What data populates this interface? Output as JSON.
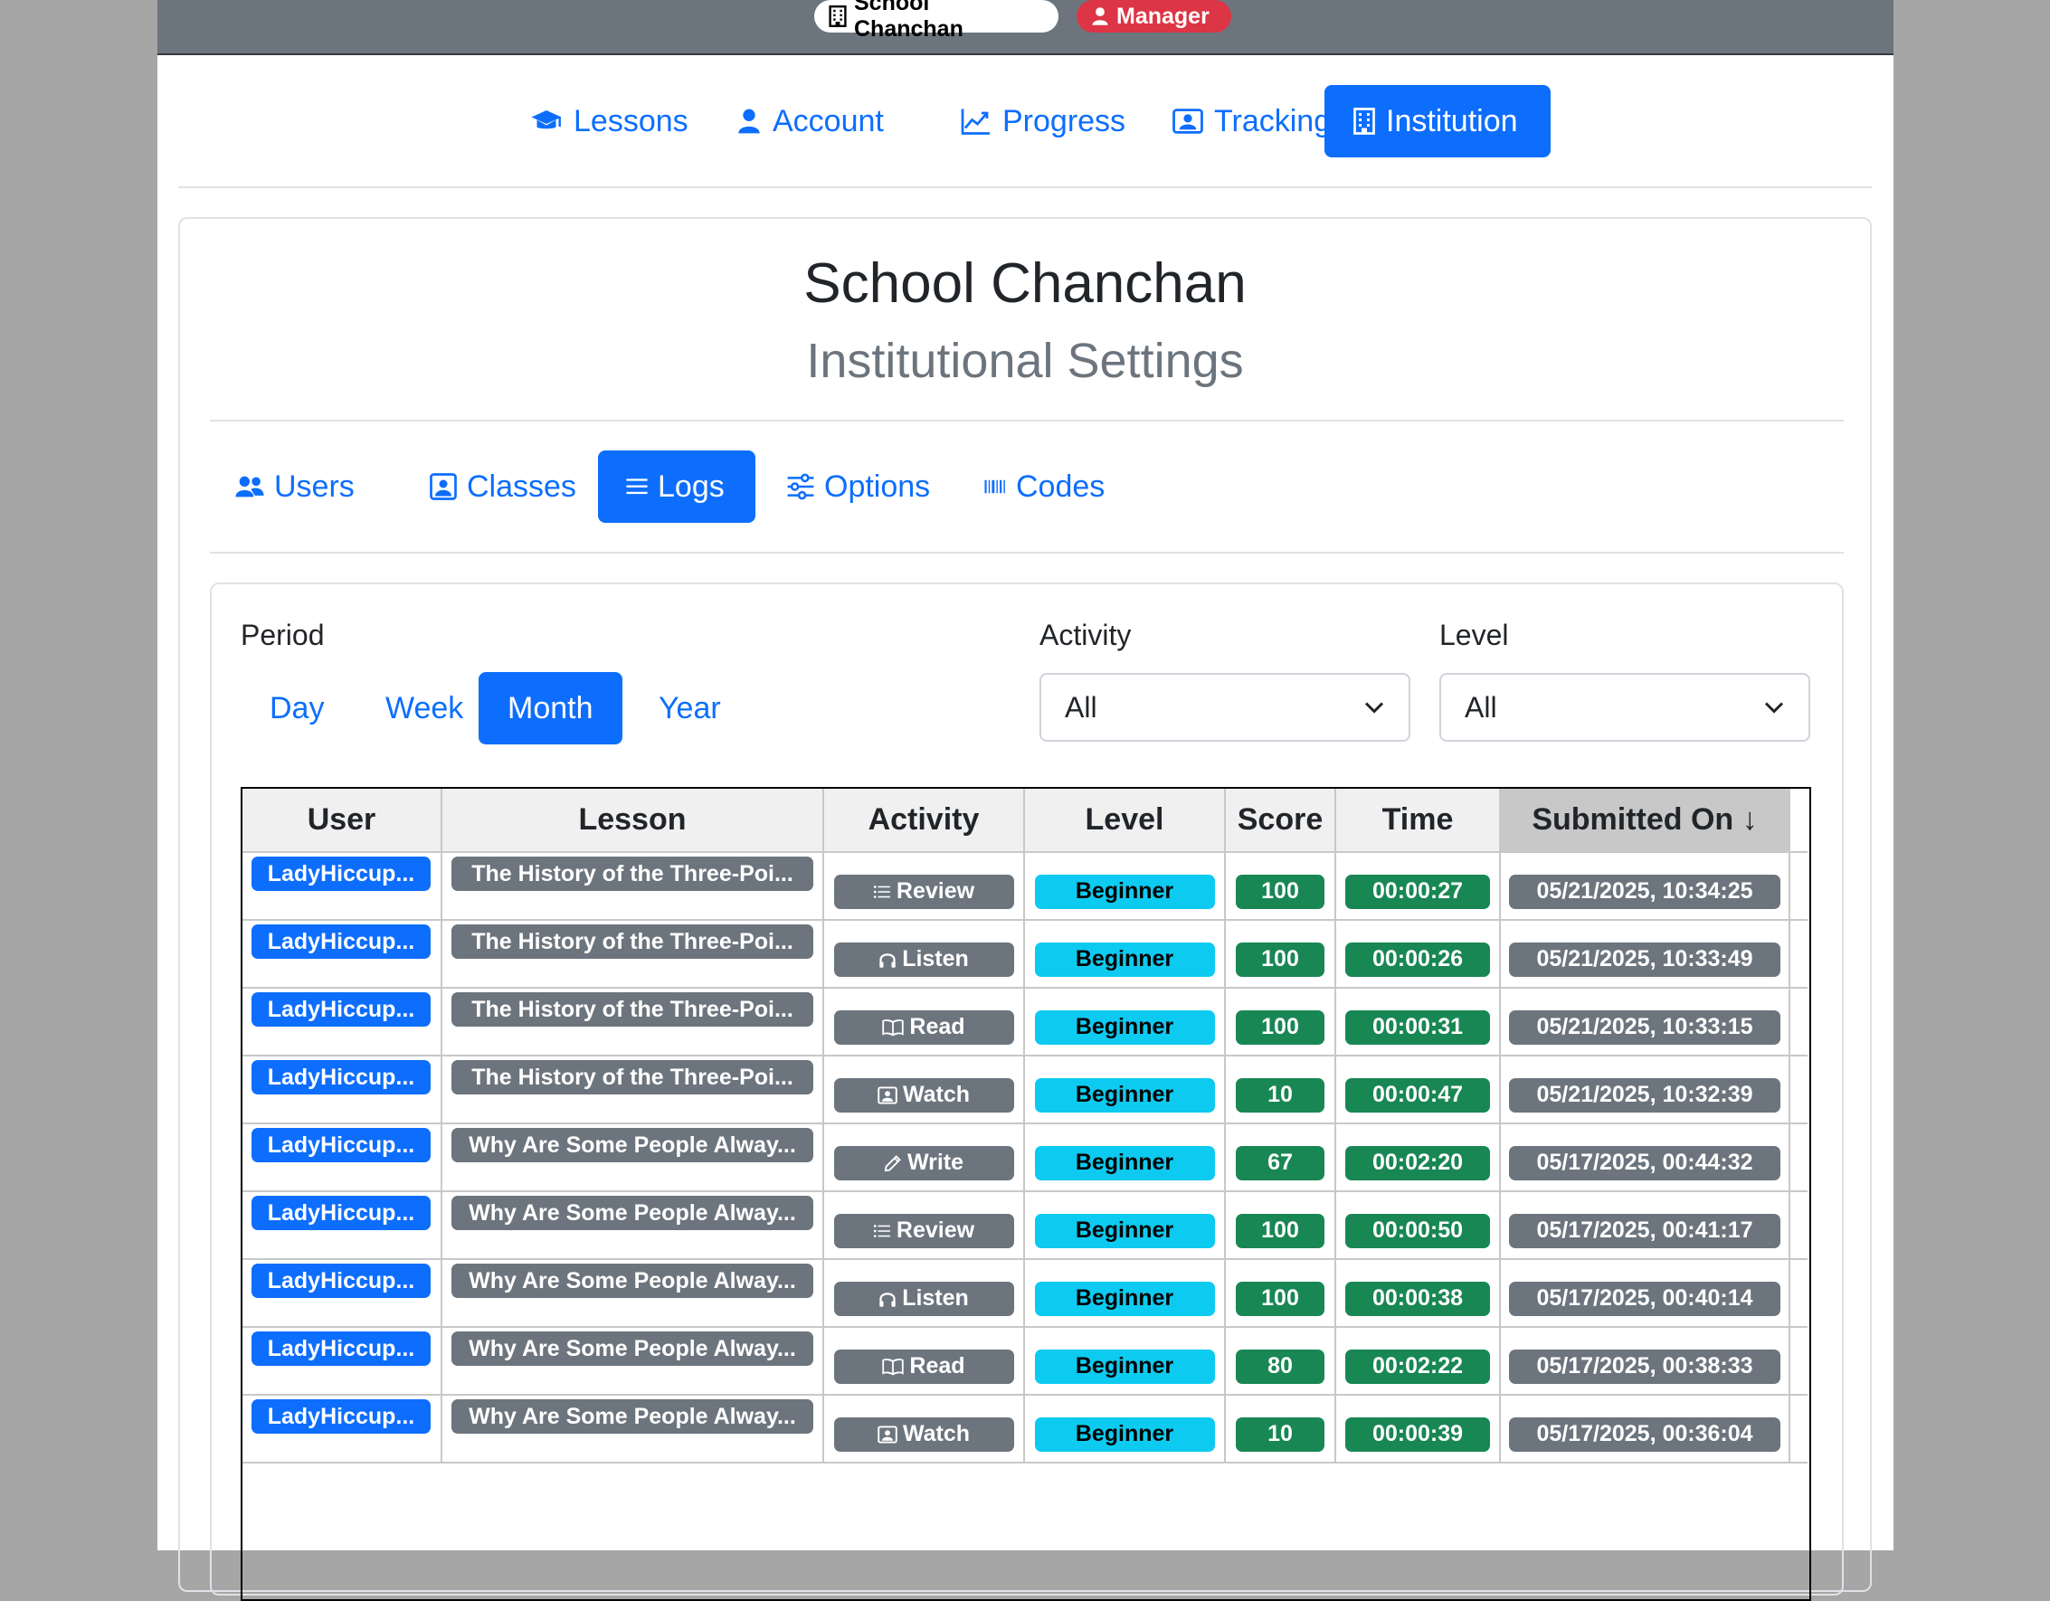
{
  "topbar": {
    "institution_badge": "School Chanchan",
    "role_badge": "Manager"
  },
  "main_nav": [
    {
      "label": "Lessons",
      "icon": "graduation-cap-icon",
      "active": false
    },
    {
      "label": "Account",
      "icon": "person-icon",
      "active": false
    },
    {
      "label": "Progress",
      "icon": "chart-line-icon",
      "active": false
    },
    {
      "label": "Tracking",
      "icon": "person-badge-icon",
      "active": false
    },
    {
      "label": "Institution",
      "icon": "building-icon",
      "active": true
    }
  ],
  "header": {
    "title": "School Chanchan",
    "subtitle": "Institutional Settings"
  },
  "sub_nav": [
    {
      "label": "Users",
      "icon": "people-icon",
      "active": false
    },
    {
      "label": "Classes",
      "icon": "person-square-icon",
      "active": false
    },
    {
      "label": "Logs",
      "icon": "list-icon",
      "active": true
    },
    {
      "label": "Options",
      "icon": "sliders-icon",
      "active": false
    },
    {
      "label": "Codes",
      "icon": "barcode-icon",
      "active": false
    }
  ],
  "filters": {
    "period_label": "Period",
    "periods": [
      "Day",
      "Week",
      "Month",
      "Year"
    ],
    "active_period": "Month",
    "activity_label": "Activity",
    "activity_value": "All",
    "level_label": "Level",
    "level_value": "All"
  },
  "table": {
    "columns": [
      "User",
      "Lesson",
      "Activity",
      "Level",
      "Score",
      "Time",
      "Submitted On ↓"
    ],
    "rows": [
      {
        "user": "LadyHiccup...",
        "lesson": "The History of the Three-Poi...",
        "activity": "Review",
        "activity_icon": "list-icon",
        "level": "Beginner",
        "score": "100",
        "time": "00:00:27",
        "submitted": "05/21/2025, 10:34:25"
      },
      {
        "user": "LadyHiccup...",
        "lesson": "The History of the Three-Poi...",
        "activity": "Listen",
        "activity_icon": "headphones-icon",
        "level": "Beginner",
        "score": "100",
        "time": "00:00:26",
        "submitted": "05/21/2025, 10:33:49"
      },
      {
        "user": "LadyHiccup...",
        "lesson": "The History of the Three-Poi...",
        "activity": "Read",
        "activity_icon": "book-icon",
        "level": "Beginner",
        "score": "100",
        "time": "00:00:31",
        "submitted": "05/21/2025, 10:33:15"
      },
      {
        "user": "LadyHiccup...",
        "lesson": "The History of the Three-Poi...",
        "activity": "Watch",
        "activity_icon": "video-icon",
        "level": "Beginner",
        "score": "10",
        "time": "00:00:47",
        "submitted": "05/21/2025, 10:32:39"
      },
      {
        "user": "LadyHiccup...",
        "lesson": "Why Are Some People Alway...",
        "activity": "Write",
        "activity_icon": "pencil-icon",
        "level": "Beginner",
        "score": "67",
        "time": "00:02:20",
        "submitted": "05/17/2025, 00:44:32"
      },
      {
        "user": "LadyHiccup...",
        "lesson": "Why Are Some People Alway...",
        "activity": "Review",
        "activity_icon": "list-icon",
        "level": "Beginner",
        "score": "100",
        "time": "00:00:50",
        "submitted": "05/17/2025, 00:41:17"
      },
      {
        "user": "LadyHiccup...",
        "lesson": "Why Are Some People Alway...",
        "activity": "Listen",
        "activity_icon": "headphones-icon",
        "level": "Beginner",
        "score": "100",
        "time": "00:00:38",
        "submitted": "05/17/2025, 00:40:14"
      },
      {
        "user": "LadyHiccup...",
        "lesson": "Why Are Some People Alway...",
        "activity": "Read",
        "activity_icon": "book-icon",
        "level": "Beginner",
        "score": "80",
        "time": "00:02:22",
        "submitted": "05/17/2025, 00:38:33"
      },
      {
        "user": "LadyHiccup...",
        "lesson": "Why Are Some People Alway...",
        "activity": "Watch",
        "activity_icon": "video-icon",
        "level": "Beginner",
        "score": "10",
        "time": "00:00:39",
        "submitted": "05/17/2025, 00:36:04"
      }
    ]
  },
  "colors": {
    "primary": "#0d6efd",
    "secondary": "#6c757d",
    "success": "#198754",
    "info": "#0dcaf0",
    "danger": "#dc3545"
  }
}
